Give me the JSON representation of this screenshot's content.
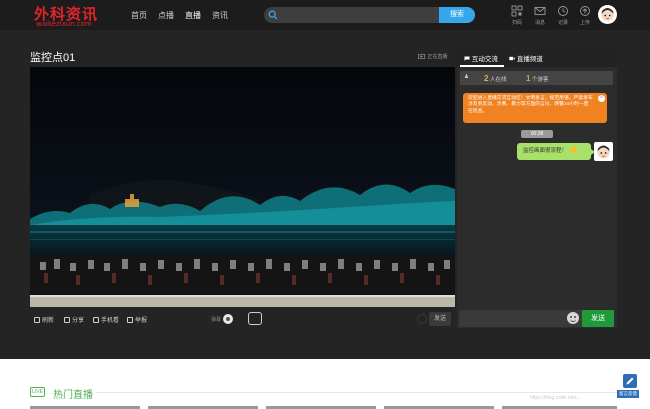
{
  "brand": {
    "logo_text": "外科资讯",
    "logo_sub": "waikezixun.com"
  },
  "nav": {
    "items": [
      "首页",
      "点播",
      "直播",
      "资讯"
    ],
    "active": "直播"
  },
  "search": {
    "placeholder": "",
    "button_label": "搜索"
  },
  "header_tools": [
    {
      "label": "扫码",
      "icon": "qrcode-icon"
    },
    {
      "label": "消息",
      "icon": "mail-icon"
    },
    {
      "label": "记录",
      "icon": "clock-icon"
    },
    {
      "label": "上传",
      "icon": "upload-icon"
    }
  ],
  "room": {
    "title": "监控点01",
    "meta": "正在直播"
  },
  "controls": {
    "refresh": "刷新",
    "share": "分享",
    "mobile": "手机看",
    "report": "举报",
    "danmu": "弹幕",
    "send": "发送"
  },
  "panel": {
    "tabs": [
      "互动交流",
      "直播频道"
    ],
    "online_count": "2",
    "online_label": "人在线",
    "viewer_count": "1",
    "viewer_label": "个游客",
    "notice": "欢迎进入直播交流互动区！文明发言，规范用语，严禁发布涉及到反动、涉黄、暴力等方面的言论，网警24小时一直在巡查。",
    "time_badge": "00:38",
    "message": "监控画面很流程！"
  },
  "chat": {
    "input_placeholder": "",
    "send_label": "发送"
  },
  "hot": {
    "icon_label": "LIVE",
    "title": "热门直播"
  },
  "watermark": "https://blog.csdn.net/...",
  "feedback_label": "留言反馈",
  "colors": {
    "accent_green": "#1d9b3a",
    "notice_orange": "#f08222",
    "search_blue": "#35a7ea",
    "brand_red": "#e1242a",
    "hot_green": "#4caf50"
  }
}
